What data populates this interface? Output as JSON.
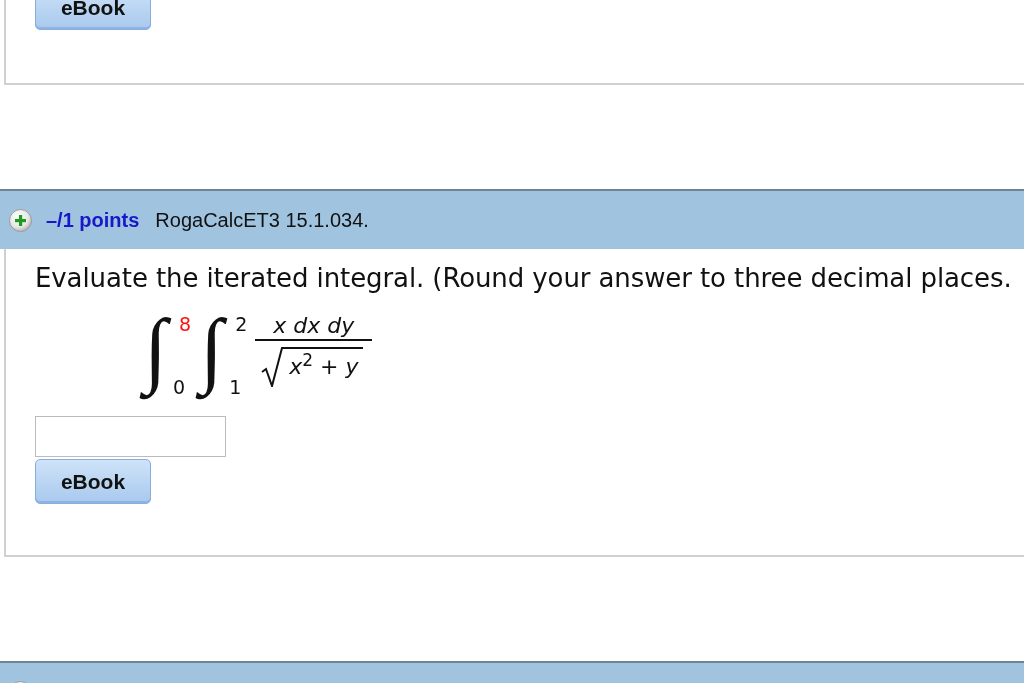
{
  "questions": [
    {
      "kind": "tail",
      "buttons": [
        "eBook"
      ]
    },
    {
      "kind": "question",
      "points": "–/1 points",
      "source": "RogaCalcET3 15.1.034.",
      "prompt": "Evaluate the iterated integral. (Round your answer to three decimal places.",
      "integral": {
        "signs": [
          {
            "symbol": "∫",
            "upper": "8",
            "upper_highlighted": true,
            "lower": "0"
          },
          {
            "symbol": "∫",
            "upper": "2",
            "upper_highlighted": false,
            "lower": "1"
          }
        ],
        "numerator": "x dx dy",
        "denominator": "*x*$^{2}$ + *y*"
      },
      "buttons": [
        "eBook"
      ]
    },
    {
      "kind": "cut_header"
    }
  ]
}
